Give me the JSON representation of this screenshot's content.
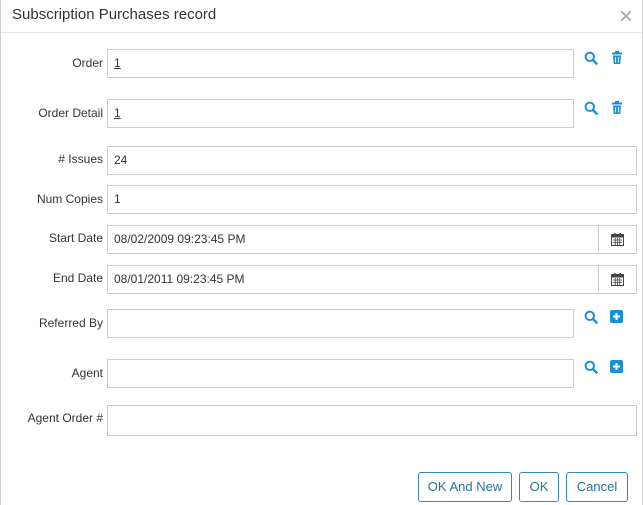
{
  "dialog": {
    "title": "Subscription Purchases record",
    "close_icon": "close-icon"
  },
  "fields": {
    "order": {
      "label": "Order",
      "value": "1"
    },
    "order_detail": {
      "label": "Order Detail",
      "value": "1"
    },
    "issues": {
      "label": "# Issues",
      "value": "24"
    },
    "num_copies": {
      "label": "Num Copies",
      "value": "1"
    },
    "start_date": {
      "label": "Start Date",
      "value": "08/02/2009 09:23:45 PM"
    },
    "end_date": {
      "label": "End Date",
      "value": "08/01/2011 09:23:45 PM"
    },
    "referred_by": {
      "label": "Referred By",
      "value": ""
    },
    "agent": {
      "label": "Agent",
      "value": ""
    },
    "agent_order": {
      "label": "Agent Order #",
      "value": ""
    }
  },
  "icons": {
    "search": "search-icon",
    "trash": "trash-icon",
    "add": "plus-square-icon",
    "calendar": "calendar-icon"
  },
  "buttons": {
    "ok_and_new": "OK And New",
    "ok": "OK",
    "cancel": "Cancel"
  },
  "colors": {
    "accent": "#1a8fd6",
    "button_border": "#3a87ad",
    "button_text": "#2a6fa0"
  }
}
